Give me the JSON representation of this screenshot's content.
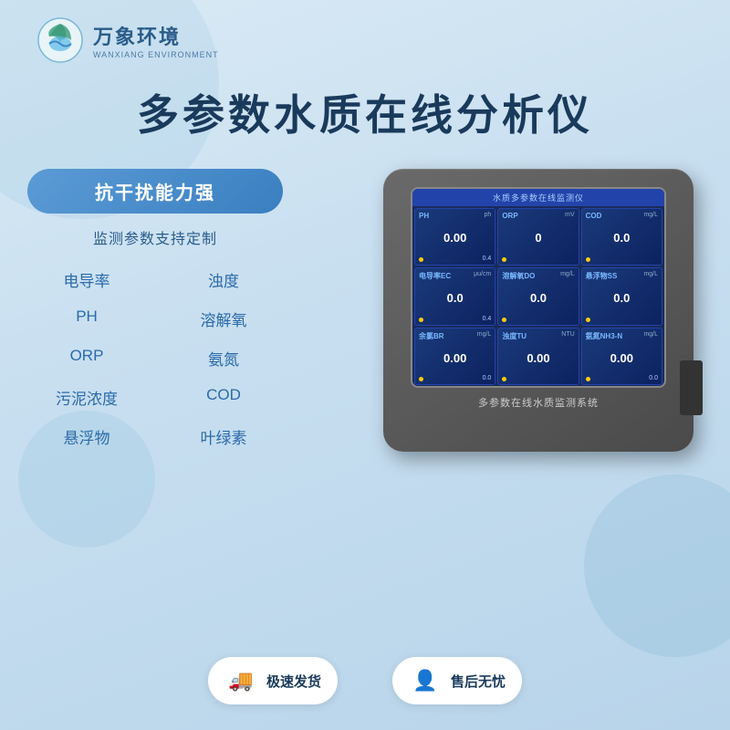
{
  "logo": {
    "cn": "万象环境",
    "en": "WANXIANG ENVIRONMENT"
  },
  "main_title": "多参数水质在线分析仪",
  "features": {
    "highlight": "抗干扰能力强",
    "subtitle": "监测参数支持定制",
    "items": [
      {
        "label": "电导率"
      },
      {
        "label": "浊度"
      },
      {
        "label": "PH"
      },
      {
        "label": "溶解氧"
      },
      {
        "label": "ORP"
      },
      {
        "label": "氨氮"
      },
      {
        "label": "污泥浓度"
      },
      {
        "label": "COD"
      },
      {
        "label": "悬浮物"
      },
      {
        "label": "叶绿素"
      }
    ]
  },
  "device": {
    "screen_title": "水质多参数在线监测仪",
    "label": "多参数在线水质监测系统",
    "cells": [
      {
        "param": "PH",
        "unit": "ph",
        "value": "0.00",
        "subval": "0.4"
      },
      {
        "param": "ORP",
        "unit": "mV",
        "value": "0",
        "subval": ""
      },
      {
        "param": "COD",
        "unit": "mg/L",
        "value": "0.0",
        "subval": ""
      },
      {
        "param": "电导率EC",
        "unit": "μu/cm",
        "value": "0.0",
        "subval": "0.4"
      },
      {
        "param": "溶解氧DO",
        "unit": "mg/L",
        "value": "0.0",
        "subval": ""
      },
      {
        "param": "悬浮物SS",
        "unit": "mg/L",
        "value": "0.0",
        "subval": ""
      },
      {
        "param": "余氯BR",
        "unit": "mg/L",
        "value": "0.00",
        "subval": "0.0"
      },
      {
        "param": "浊度TU",
        "unit": "NTU",
        "value": "0.00",
        "subval": ""
      },
      {
        "param": "氨氮NH3-N",
        "unit": "mg/L",
        "value": "0.00",
        "subval": "0.0"
      }
    ]
  },
  "badges": [
    {
      "icon": "🚚",
      "text": "极速发货"
    },
    {
      "icon": "👤",
      "text": "售后无忧"
    }
  ]
}
